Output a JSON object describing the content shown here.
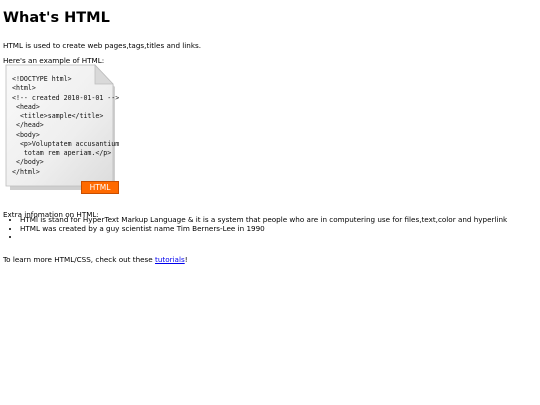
{
  "page": {
    "title": "What's HTML",
    "intro": "HTML is used to create web pages,tags,titles and links.",
    "example_label": "Here's an example of HTML:",
    "example_image": {
      "code_lines": [
        "<!DOCTYPE html>",
        "<html>",
        "<!-- created 2010-01-01 -->",
        " <head>",
        "  <title>sample</title>",
        " </head>",
        " <body>",
        "  <p>Voluptatem accusantium",
        "   totam rem aperiam.</p>",
        " </body>",
        "</html>"
      ],
      "badge": "HTML",
      "badge_color": "#ff6a00"
    },
    "extra_heading": "Extra infomation on HTML:",
    "extra_items": [
      "HTMl is stand for HyperText Markup Language & it is a system that people who are in computering use for files,text,color and hyperlink",
      "HTML was created by a guy scientist name Tim Berners-Lee in 1990",
      ""
    ],
    "learn_more_prefix": "To learn more HTML/CSS, check out these ",
    "learn_more_link": "tutorials",
    "learn_more_suffix": "!",
    "link_color": "#0000ee"
  }
}
